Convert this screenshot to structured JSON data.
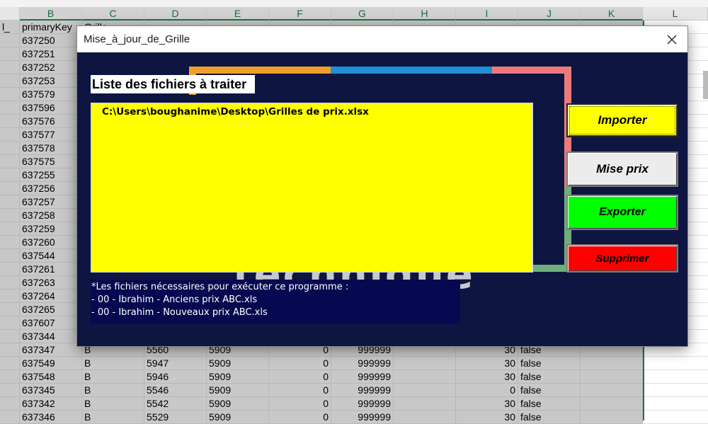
{
  "sheet": {
    "columns": [
      "",
      "B",
      "C",
      "D",
      "E",
      "F",
      "G",
      "H",
      "I",
      "J",
      "K",
      "L"
    ],
    "row1": [
      "l_",
      "primaryKey",
      "Grille",
      "...",
      "...",
      "...",
      "...",
      "...",
      "...",
      "...",
      "...",
      ""
    ],
    "keys": [
      "637250",
      "637251",
      "637252",
      "637253",
      "637579",
      "637596",
      "637576",
      "637577",
      "637578",
      "637575",
      "637255",
      "637256",
      "637257",
      "637258",
      "637259",
      "637260",
      "637544",
      "637261",
      "637263",
      "637264",
      "637265",
      "637607",
      "637344"
    ],
    "bottom_rows": [
      [
        "637347",
        "B",
        "5560",
        "5909",
        "0",
        "999999",
        "",
        "30",
        "false"
      ],
      [
        "637549",
        "B",
        "5947",
        "5909",
        "0",
        "999999",
        "",
        "30",
        "false"
      ],
      [
        "637548",
        "B",
        "5946",
        "5909",
        "0",
        "999999",
        "",
        "30",
        "false"
      ],
      [
        "637345",
        "B",
        "5546",
        "5909",
        "0",
        "999999",
        "",
        "0",
        "false"
      ],
      [
        "637342",
        "B",
        "5542",
        "5909",
        "0",
        "999999",
        "",
        "30",
        "false"
      ],
      [
        "637346",
        "B",
        "5529",
        "5909",
        "0",
        "999999",
        "",
        "30",
        "false"
      ]
    ]
  },
  "dialog": {
    "title": "Mise_à_jour_de_Grille",
    "close_icon": "close-icon",
    "list_heading": "Liste des fichiers à traiter",
    "files": [
      "C:\\Users\\boughanime\\Desktop\\Grilles de prix.xlsx"
    ],
    "notes": [
      "*Les fichiers nécessaires pour exécuter ce programme :",
      "- 00 - Ibrahim - Anciens prix ABC.xls",
      "- 00 - Ibrahim - Nouveaux prix ABC.xls"
    ],
    "logo_word": "technique",
    "buttons": {
      "importer": "Importer",
      "mise_prix": "Mise prix",
      "exporter": "Exporter",
      "supprimer": "Supprimer"
    },
    "colors": {
      "background": "#0e1540",
      "list_background": "#ffff00",
      "importer": "#ffff00",
      "exporter": "#00ff00",
      "supprimer": "#ff0000"
    }
  }
}
